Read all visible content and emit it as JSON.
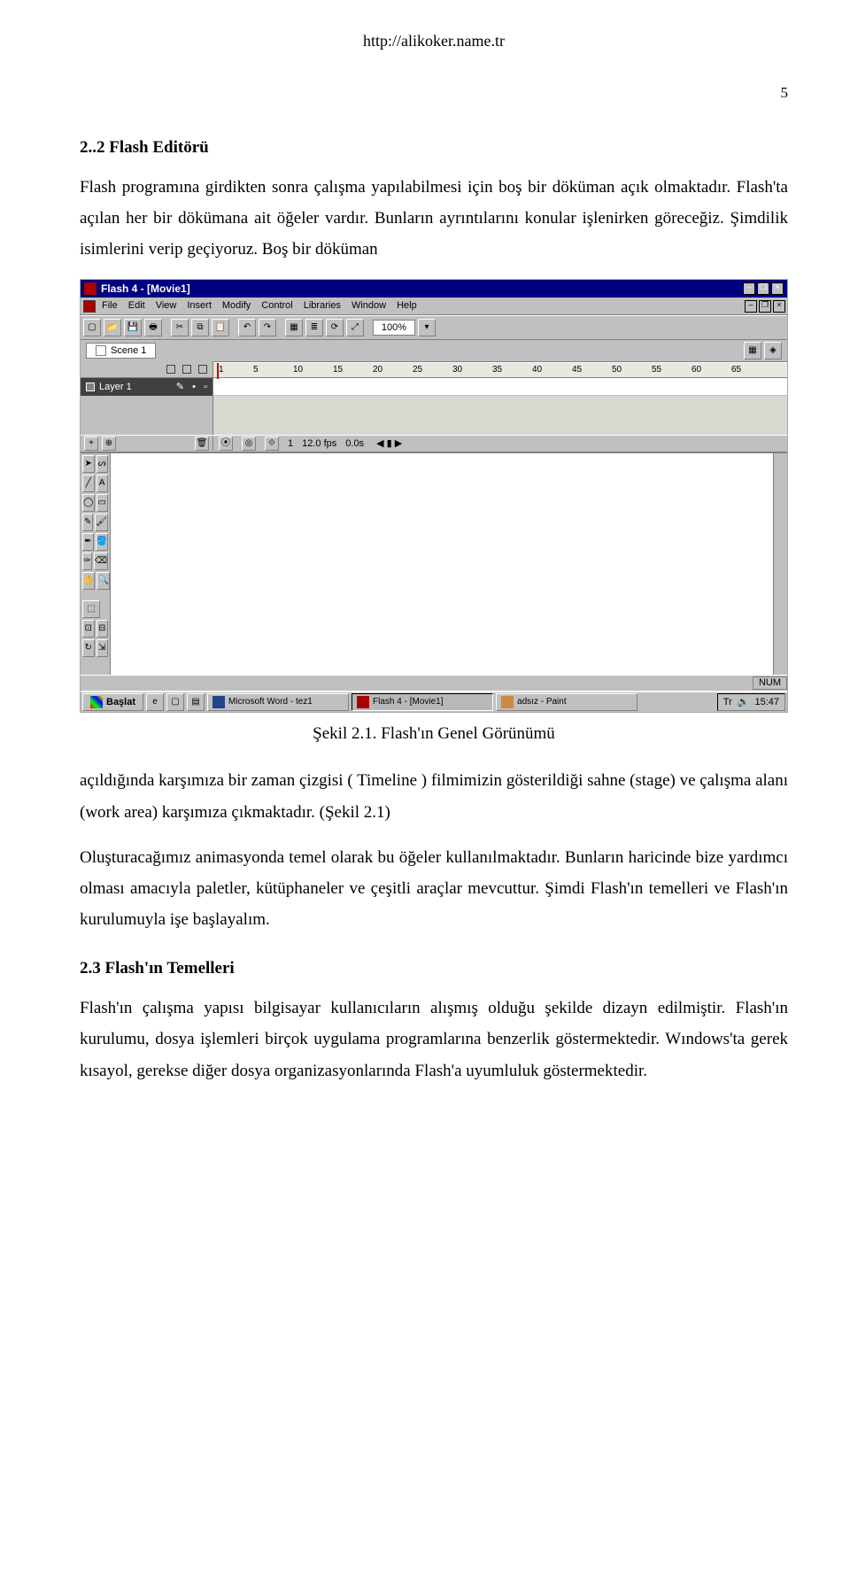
{
  "page": {
    "url": "http://alikoker.name.tr",
    "number": "5",
    "heading_22": "2..2 Flash Editörü",
    "para_1": "Flash programına girdikten sonra çalışma yapılabilmesi için boş bir döküman açık olmaktadır. Flash'ta açılan her bir dökümana ait öğeler vardır. Bunların ayrıntılarını konular işlenirken göreceğiz. Şimdilik isimlerini verip geçiyoruz. Boş bir döküman",
    "figure_caption": "Şekil 2.1. Flash'ın Genel Görünümü",
    "para_2": "açıldığında karşımıza bir zaman çizgisi ( Timeline ) filmimizin gösterildiği sahne (stage) ve çalışma alanı (work area) karşımıza çıkmaktadır.   (Şekil 2.1)",
    "para_3": "Oluşturacağımız animasyonda temel olarak bu öğeler kullanılmaktadır. Bunların haricinde bize yardımcı olması amacıyla paletler, kütüphaneler ve çeşitli araçlar mevcuttur. Şimdi Flash'ın temelleri ve Flash'ın kurulumuyla işe başlayalım.",
    "heading_23": "2.3 Flash'ın Temelleri",
    "para_4": "Flash'ın çalışma yapısı bilgisayar kullanıcıların alışmış olduğu şekilde dizayn edilmiştir. Flash'ın kurulumu, dosya işlemleri birçok uygulama programlarına benzerlik göstermektedir. Wındows'ta gerek kısayol, gerekse diğer dosya organizasyonlarında Flash'a uyumluluk göstermektedir."
  },
  "shot": {
    "title": "Flash 4 - [Movie1]",
    "menus": [
      "File",
      "Edit",
      "View",
      "Insert",
      "Modify",
      "Control",
      "Libraries",
      "Window",
      "Help"
    ],
    "zoom": "100%",
    "scene_label": "Scene 1",
    "ruler_ticks": [
      "1",
      "5",
      "10",
      "15",
      "20",
      "25",
      "30",
      "35",
      "40",
      "45",
      "50",
      "55",
      "60",
      "65"
    ],
    "layer_name": "Layer 1",
    "tl_frame": "1",
    "tl_fps": "12.0 fps",
    "tl_time": "0.0s",
    "status_num": "NUM",
    "start_label": "Başlat",
    "task_items": [
      {
        "label": "Microsoft Word - tez1",
        "active": false
      },
      {
        "label": "Flash 4 - [Movie1]",
        "active": true
      },
      {
        "label": "adsız - Paint",
        "active": false
      }
    ],
    "tray_lang": "Tr",
    "tray_time": "15:47"
  }
}
